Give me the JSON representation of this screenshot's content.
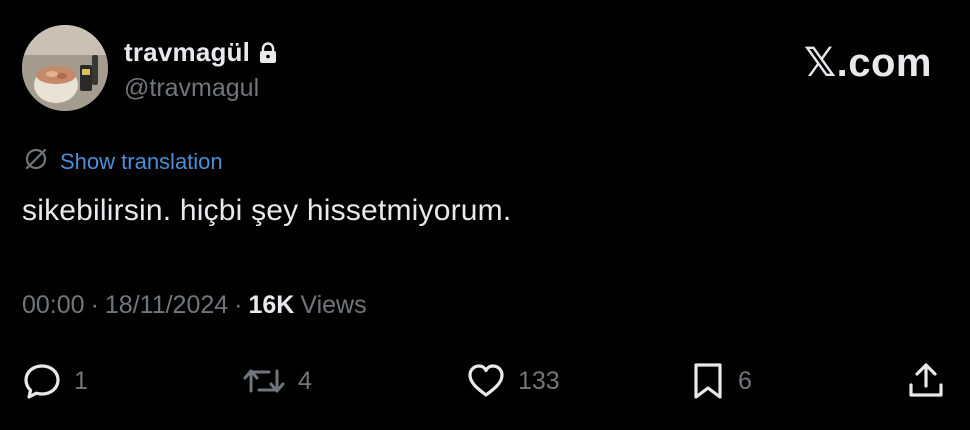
{
  "user": {
    "display_name": "travmagül",
    "handle": "@travmagul",
    "avatar_icon": "avatar-photo",
    "locked_icon": "lock-icon"
  },
  "brand": {
    "text": "𝕏.com"
  },
  "translation": {
    "label": "Show translation",
    "icon": "translate-icon"
  },
  "tweet": {
    "text": "sikebilirsin. hiçbi şey hissetmiyorum."
  },
  "meta": {
    "time": "00:00",
    "separator": "·",
    "date": "18/11/2024",
    "views_count": "16K",
    "views_label": "Views"
  },
  "actions": {
    "replies": "1",
    "reposts": "4",
    "likes": "133",
    "bookmarks": "6"
  },
  "colors": {
    "background": "#000000",
    "text_primary": "#e7e9ea",
    "text_secondary": "#71767b",
    "link": "#4b8fd6"
  }
}
